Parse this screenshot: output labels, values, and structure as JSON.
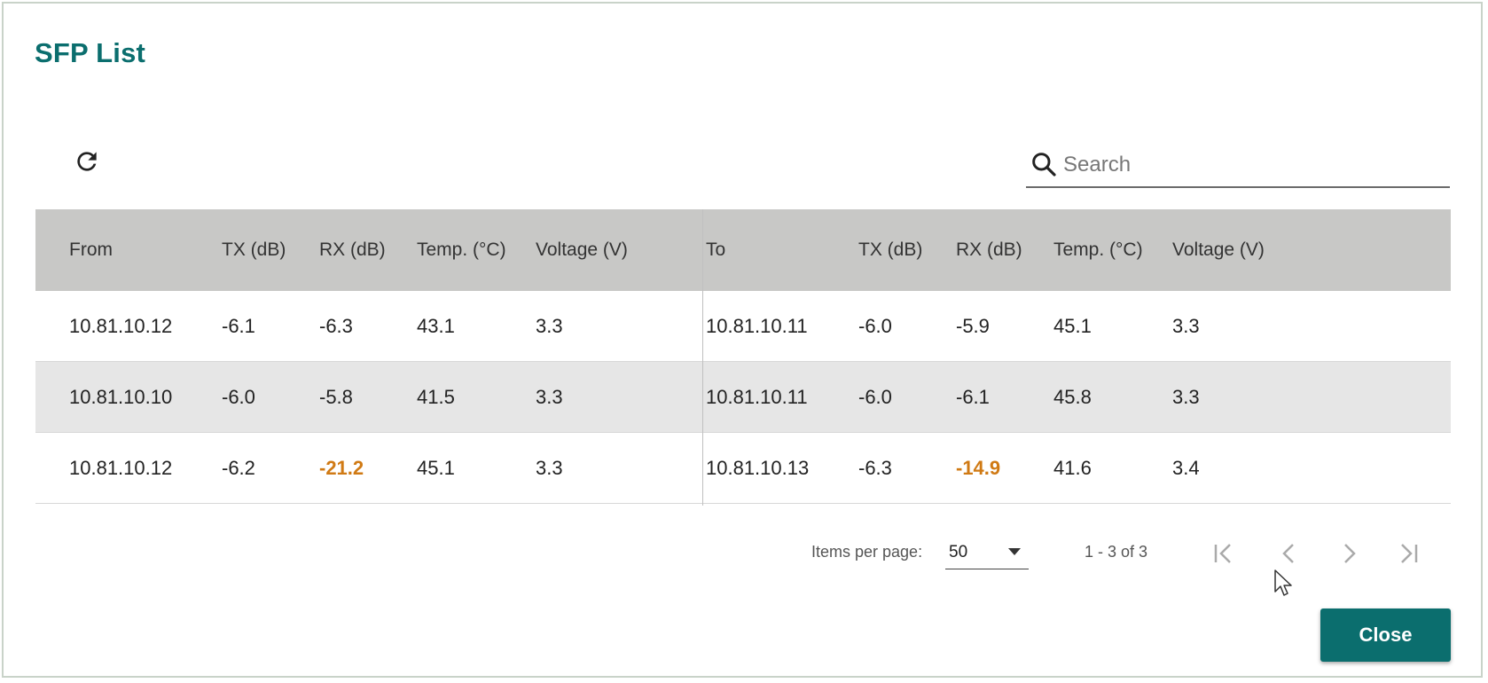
{
  "dialog": {
    "title": "SFP List"
  },
  "toolbar": {
    "refresh_icon": "refresh-icon"
  },
  "search": {
    "placeholder": "Search",
    "value": "",
    "icon": "search-icon"
  },
  "table": {
    "headers": [
      "From",
      "TX (dB)",
      "RX (dB)",
      "Temp. (°C)",
      "Voltage (V)",
      "To",
      "TX (dB)",
      "RX (dB)",
      "Temp. (°C)",
      "Voltage (V)"
    ],
    "rows": [
      [
        "10.81.10.12",
        "-6.1",
        "-6.3",
        "43.1",
        "3.3",
        "10.81.10.11",
        "-6.0",
        "-5.9",
        "45.1",
        "3.3"
      ],
      [
        "10.81.10.10",
        "-6.0",
        "-5.8",
        "41.5",
        "3.3",
        "10.81.10.11",
        "-6.0",
        "-6.1",
        "45.8",
        "3.3"
      ],
      [
        "10.81.10.12",
        "-6.2",
        "-21.2",
        "45.1",
        "3.3",
        "10.81.10.13",
        "-6.3",
        "-14.9",
        "41.6",
        "3.4"
      ]
    ],
    "warning_color": "#d07a14",
    "header_bg": "#c8c8c6",
    "alt_row_bg": "#e6e6e6"
  },
  "pager": {
    "items_per_page_label": "Items per page:",
    "items_per_page_value": "50",
    "range_label": "1 - 3 of 3"
  },
  "actions": {
    "close_label": "Close"
  },
  "colors": {
    "accent": "#0b6e6e"
  }
}
